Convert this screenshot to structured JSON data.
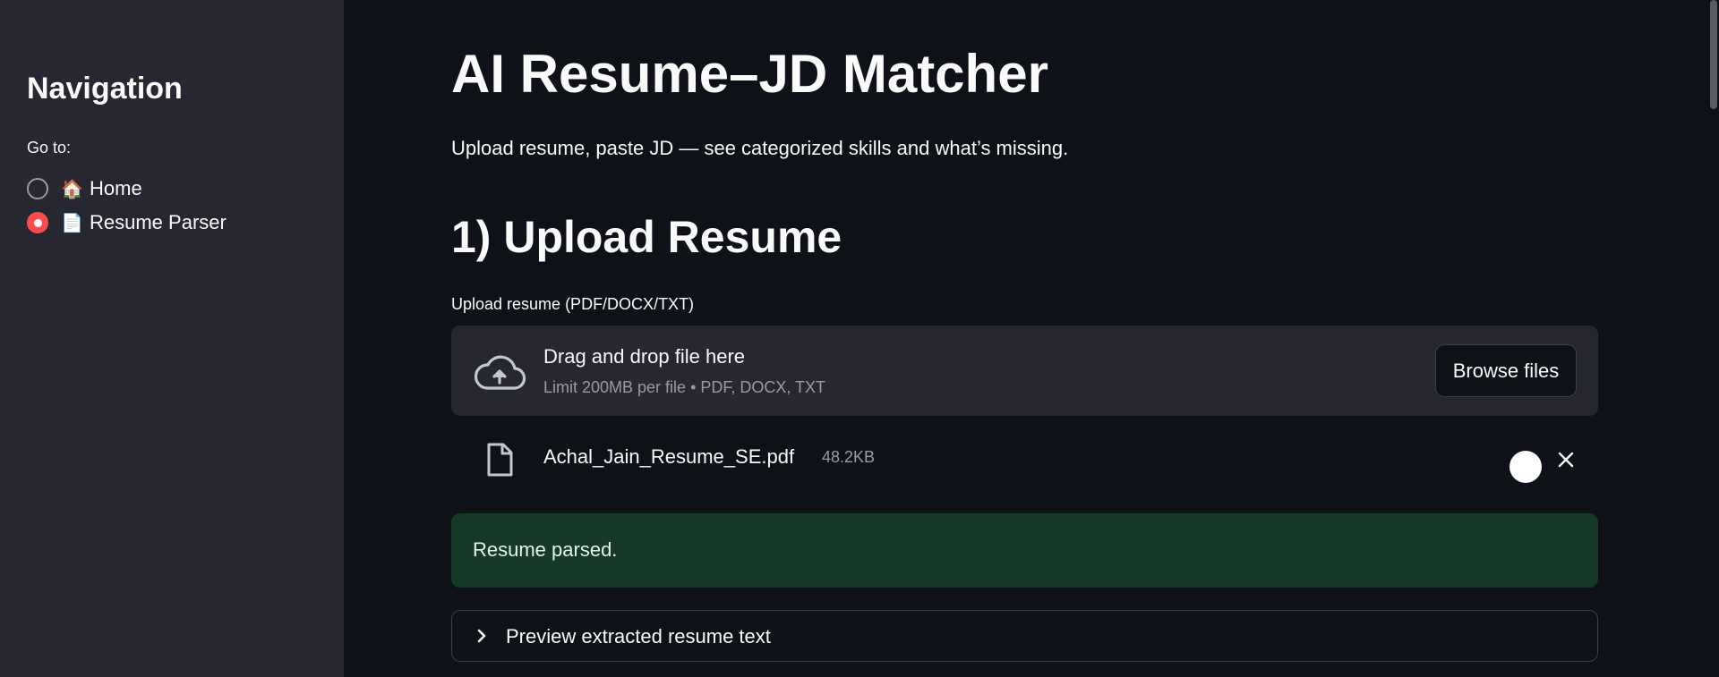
{
  "sidebar": {
    "title": "Navigation",
    "goto_label": "Go to:",
    "options": [
      {
        "emoji": "🏠",
        "label": "Home",
        "selected": false
      },
      {
        "emoji": "📄",
        "label": "Resume Parser",
        "selected": true
      }
    ]
  },
  "main": {
    "title": "AI Resume–JD Matcher",
    "subtitle": "Upload resume, paste JD — see categorized skills and what’s missing.",
    "section1_heading": "1) Upload Resume",
    "upload_label": "Upload resume (PDF/DOCX/TXT)",
    "dropzone": {
      "title": "Drag and drop file here",
      "subtitle": "Limit 200MB per file • PDF, DOCX, TXT",
      "browse_label": "Browse files"
    },
    "file": {
      "name": "Achal_Jain_Resume_SE.pdf",
      "size": "48.2KB"
    },
    "success_message": "Resume parsed.",
    "expander_label": "Preview extracted resume text"
  },
  "colors": {
    "accent": "#ff4b4b",
    "background": "#0e1117",
    "sidebar": "#262730",
    "success_bg": "#173928"
  }
}
